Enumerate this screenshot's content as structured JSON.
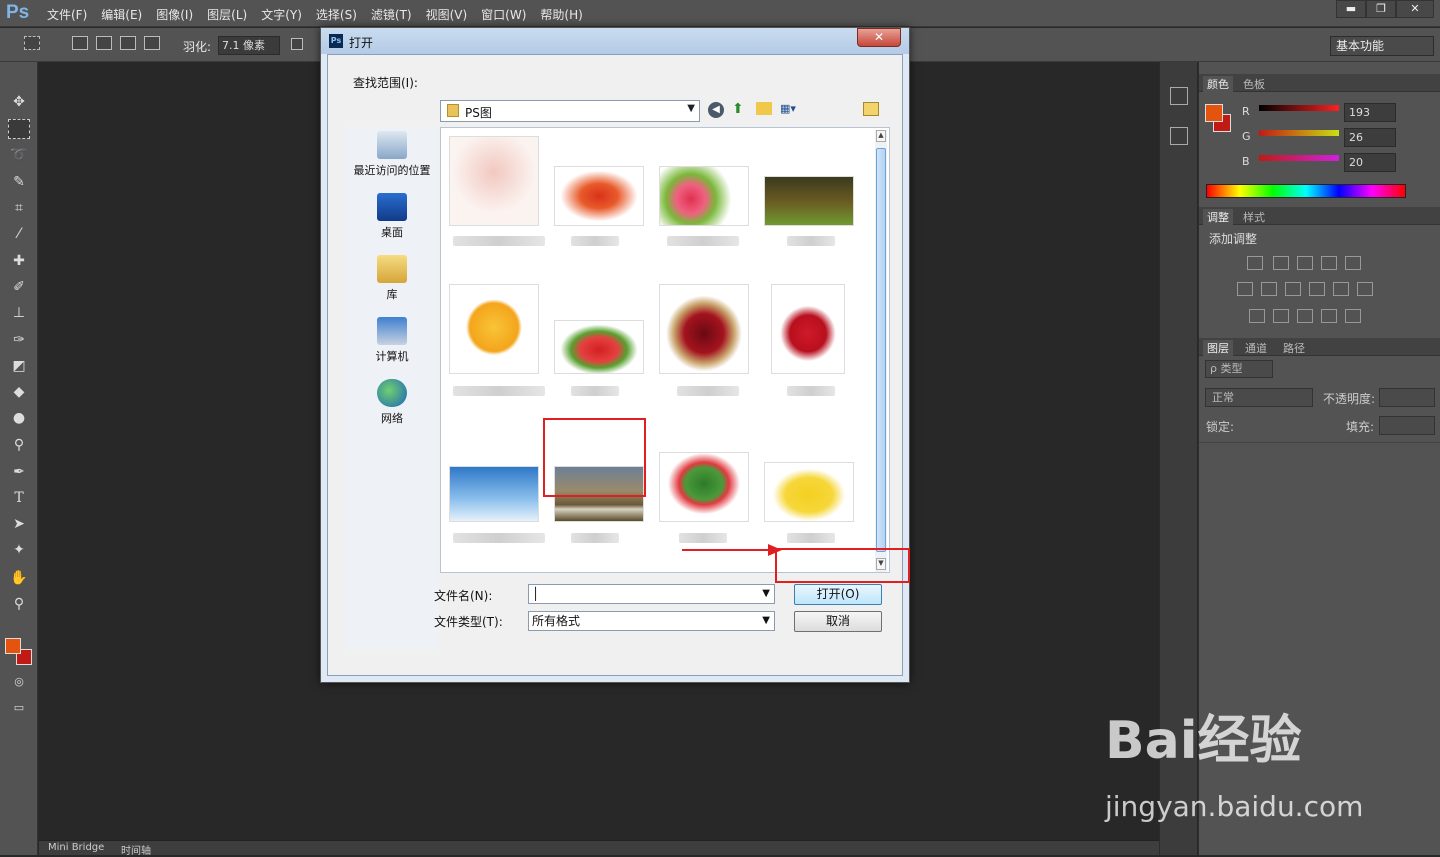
{
  "app": {
    "logo": "Ps"
  },
  "menu": [
    "文件(F)",
    "编辑(E)",
    "图像(I)",
    "图层(L)",
    "文字(Y)",
    "选择(S)",
    "滤镜(T)",
    "视图(V)",
    "窗口(W)",
    "帮助(H)"
  ],
  "window_controls": {
    "minimize": "▬",
    "restore": "❐",
    "close": "✕"
  },
  "options": {
    "feather_label": "羽化:",
    "feather_value": "7.1 像素",
    "workspace": "基本功能"
  },
  "dialog": {
    "title": "打开",
    "look_in_label": "查找范围(I):",
    "look_in_value": "PS图",
    "places": [
      "最近访问的位置",
      "桌面",
      "库",
      "计算机",
      "网络"
    ],
    "filename_label": "文件名(N):",
    "filename_value": "",
    "filetype_label": "文件类型(T):",
    "filetype_value": "所有格式",
    "open_button": "打开(O)",
    "cancel_button": "取消",
    "thumbnails": [
      "hands",
      "crayfish",
      "lychee",
      "forest",
      "emoji",
      "strawberry",
      "cherries",
      "apple",
      "sky",
      "sheep",
      "watermelon",
      "banana"
    ],
    "selected": "sheep"
  },
  "panels": {
    "color_tabs": [
      "颜色",
      "色板"
    ],
    "channels": [
      {
        "name": "R",
        "value": "193"
      },
      {
        "name": "G",
        "value": "26"
      },
      {
        "name": "B",
        "value": "20"
      }
    ],
    "adjust_tabs": [
      "调整",
      "样式"
    ],
    "adjust_title": "添加调整",
    "layer_tabs": [
      "图层",
      "通道",
      "路径"
    ],
    "layer_filter": "ρ 类型",
    "blend_mode": "正常",
    "opacity_label": "不透明度:",
    "lock_label": "锁定:",
    "fill_label": "填充:",
    "fg_color": "#e5540f",
    "bg_color": "#c11a14"
  },
  "bottom_tabs": [
    "Mini Bridge",
    "时间轴"
  ],
  "watermark": {
    "brand": "Bai经验",
    "url": "jingyan.baidu.com"
  }
}
